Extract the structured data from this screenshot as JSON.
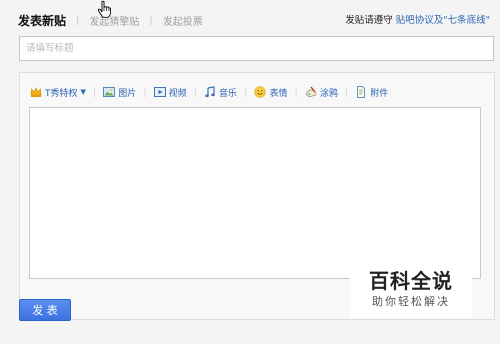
{
  "tabs": [
    {
      "label": "发表新贴",
      "active": true
    },
    {
      "label": "发起猜擎贴",
      "active": false
    },
    {
      "label": "发起投票",
      "active": false
    }
  ],
  "notice": {
    "prefix": "发贴请遵守",
    "link": "贴吧协议及\"七条底线\""
  },
  "title_input": {
    "placeholder": "请填写标题",
    "value": ""
  },
  "toolbar": {
    "items": [
      {
        "label": "T秀特权",
        "icon": "crown-icon"
      },
      {
        "label": "图片",
        "icon": "picture-icon"
      },
      {
        "label": "视频",
        "icon": "video-icon"
      },
      {
        "label": "音乐",
        "icon": "music-icon"
      },
      {
        "label": "表情",
        "icon": "smiley-icon"
      },
      {
        "label": "涂鸦",
        "icon": "doodle-icon"
      },
      {
        "label": "附件",
        "icon": "attachment-icon"
      }
    ]
  },
  "editor": {
    "content": ""
  },
  "submit": {
    "label": "发 表"
  },
  "watermark": {
    "title": "百科全说",
    "subtitle": "助你轻松解决"
  },
  "colors": {
    "link": "#2d64b3",
    "button": "#3c72e0"
  }
}
